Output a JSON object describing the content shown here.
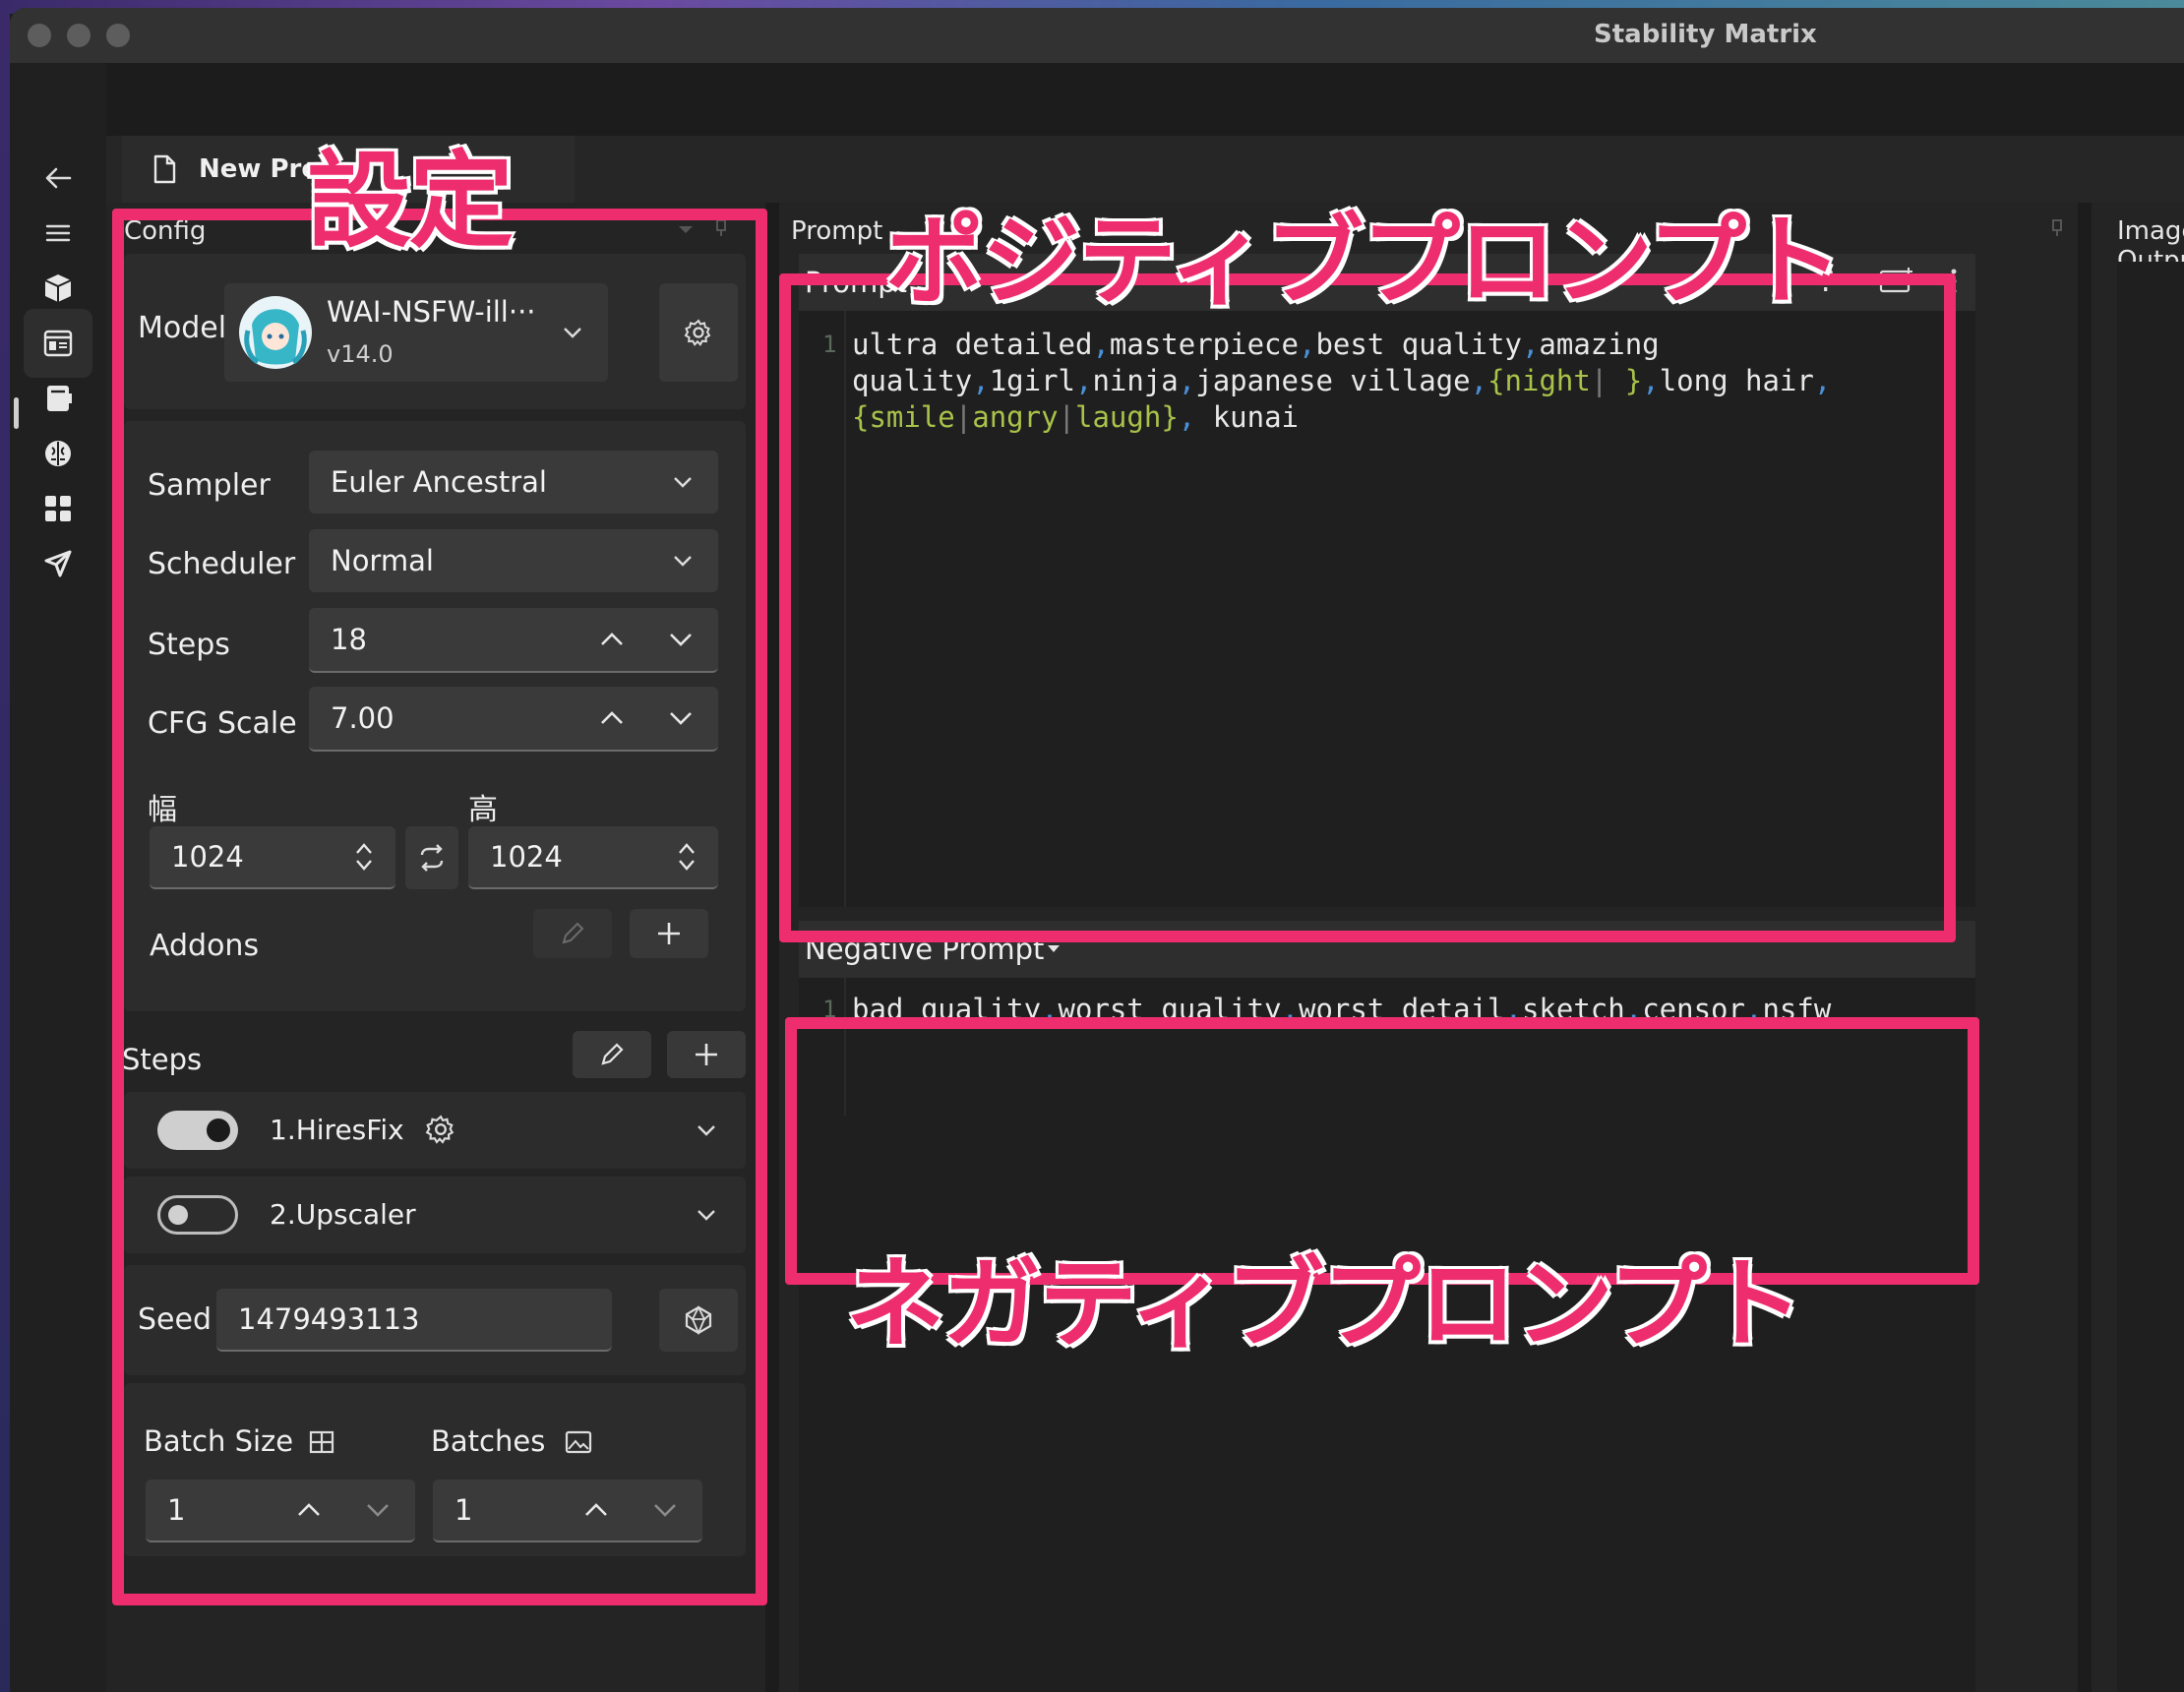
{
  "window": {
    "title": "Stability Matrix"
  },
  "tab": {
    "label": "New Proje"
  },
  "sidebar": {
    "items": [
      "back-arrow-icon",
      "menu-icon",
      "package-icon",
      "inference-icon",
      "checkpoints-icon",
      "brain-icon",
      "grid-icon",
      "share-icon"
    ]
  },
  "config": {
    "header": "Config",
    "model": {
      "label": "Model",
      "name": "WAI-NSFW-ill···",
      "version": "v14.0"
    },
    "sampler": {
      "label": "Sampler",
      "value": "Euler Ancestral"
    },
    "scheduler": {
      "label": "Scheduler",
      "value": "Normal"
    },
    "steps": {
      "label": "Steps",
      "value": "18"
    },
    "cfg": {
      "label": "CFG Scale",
      "value": "7.00"
    },
    "width": {
      "label": "幅",
      "value": "1024"
    },
    "height": {
      "label": "高",
      "value": "1024"
    },
    "addons": {
      "label": "Addons"
    },
    "steps_section": {
      "label": "Steps"
    },
    "hiresfix": {
      "label": "1.HiresFix",
      "enabled": true
    },
    "upscaler": {
      "label": "2.Upscaler",
      "enabled": false
    },
    "seed": {
      "label": "Seed",
      "value": "1479493113"
    },
    "batch_size": {
      "label": "Batch Size",
      "value": "1"
    },
    "batches": {
      "label": "Batches",
      "value": "1"
    }
  },
  "prompt": {
    "panel_header": "Prompt",
    "header": "Prompt",
    "line_number": "1",
    "help": "?"
  },
  "negative": {
    "header": "Negative Prompt",
    "line_number": "1"
  },
  "image_output": {
    "header": "Image Output"
  },
  "annotations": {
    "settings": "設定",
    "positive": "ポジティブプロンプト",
    "negative": "ネガティブプロンプト",
    "color": "#ee2d6e"
  }
}
